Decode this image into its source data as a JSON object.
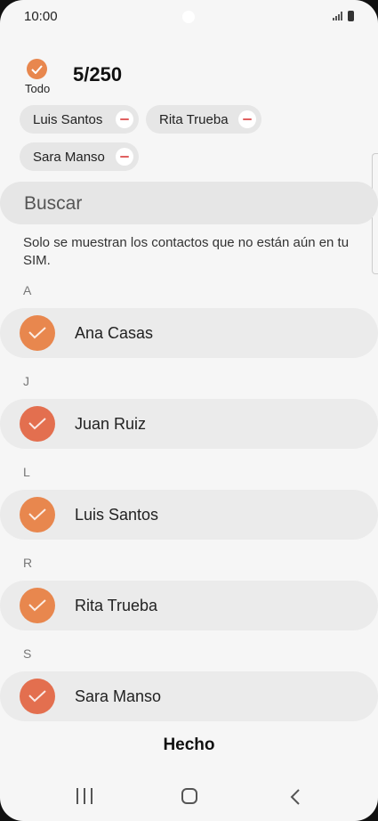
{
  "status_bar": {
    "time": "10:00"
  },
  "selection": {
    "all_label": "Todo",
    "count": "5/250"
  },
  "chips": [
    {
      "label": "Luis Santos"
    },
    {
      "label": "Rita Trueba"
    },
    {
      "label": "Sara Manso"
    }
  ],
  "search": {
    "placeholder": "Buscar"
  },
  "info_text": "Solo se muestran los contactos que no están aún en tu SIM.",
  "sections": [
    {
      "letter": "A",
      "contact": "Ana Casas",
      "checked": true
    },
    {
      "letter": "J",
      "contact": "Juan Ruiz",
      "checked": true
    },
    {
      "letter": "L",
      "contact": "Luis Santos",
      "checked": true
    },
    {
      "letter": "R",
      "contact": "Rita Trueba",
      "checked": true
    },
    {
      "letter": "S",
      "contact": "Sara Manso",
      "checked": true
    }
  ],
  "done_button": "Hecho",
  "colors": {
    "accent": "#e8874e",
    "accent_alt": "#e36f4f",
    "background": "#f6f6f6",
    "row": "#ebebeb"
  },
  "icons": {
    "selected": "check-icon",
    "remove": "minus-icon"
  }
}
